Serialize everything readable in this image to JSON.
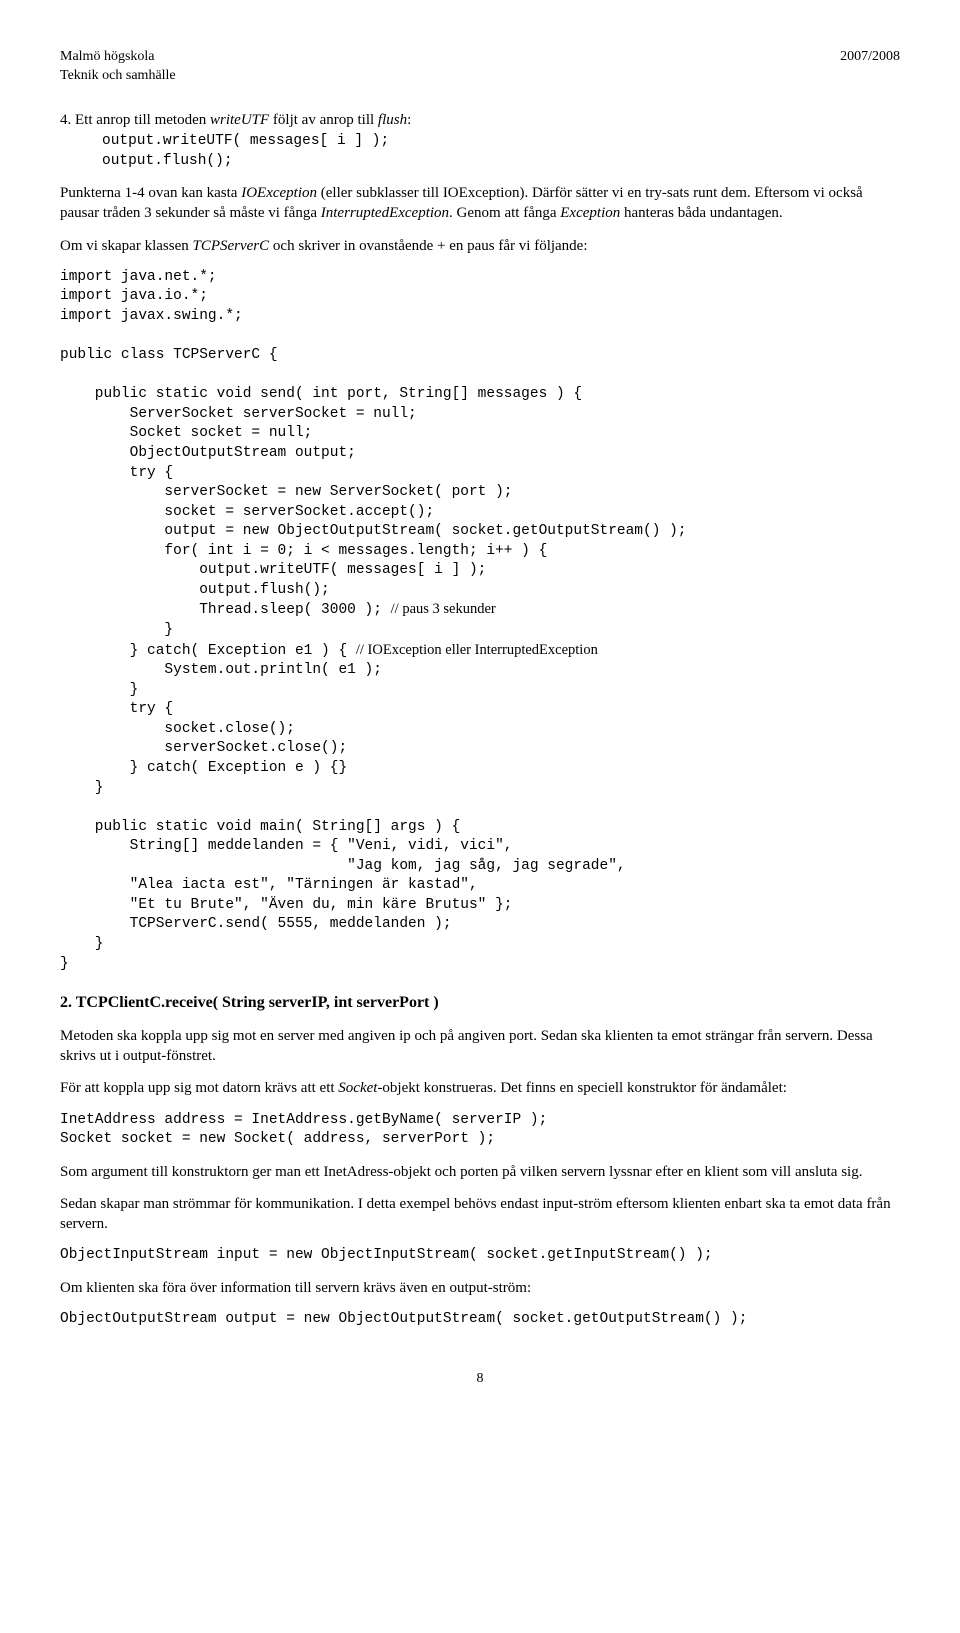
{
  "header": {
    "left_line1": "Malmö högskola",
    "left_line2": "Teknik och samhälle",
    "right": "2007/2008"
  },
  "item4": {
    "num": "4.",
    "text_plain1": "Ett anrop till metoden ",
    "text_italic1": "writeUTF",
    "text_plain2": " följt av anrop till ",
    "text_italic2": "flush",
    "text_plain3": ":",
    "code": "output.writeUTF( messages[ i ] );\noutput.flush();"
  },
  "para1": {
    "p1": "Punkterna 1-4 ovan kan kasta ",
    "i1": "IOException",
    "p2": " (eller subklasser till IOException). Därför sätter vi en try-sats runt dem. Eftersom vi också pausar tråden 3 sekunder så måste vi fånga ",
    "i2": "InterruptedException",
    "p3": ". Genom att fånga ",
    "i3": "Exception",
    "p4": " hanteras båda undantagen."
  },
  "para2": {
    "p1": "Om vi skapar klassen ",
    "i1": "TCPServerC",
    "p2": " och skriver in ovanstående + en paus får vi följande:"
  },
  "code_big": {
    "l1": "import java.net.*;",
    "l2": "import java.io.*;",
    "l3": "import javax.swing.*;",
    "l4": "public class TCPServerC {",
    "l5": "    public static void send( int port, String[] messages ) {",
    "l6": "        ServerSocket serverSocket = null;",
    "l7": "        Socket socket = null;",
    "l8": "        ObjectOutputStream output;",
    "l9": "        try {",
    "l10": "            serverSocket = new ServerSocket( port );",
    "l11": "            socket = serverSocket.accept();",
    "l12": "            output = new ObjectOutputStream( socket.getOutputStream() );",
    "l13": "            for( int i = 0; i < messages.length; i++ ) {",
    "l14": "                output.writeUTF( messages[ i ] );",
    "l15": "                output.flush();",
    "l16a": "                Thread.sleep( 3000 ); ",
    "l16b": "// paus 3 sekunder",
    "l17": "            }",
    "l18a": "        } catch( Exception e1 ) { ",
    "l18b": "// IOException eller InterruptedException",
    "l19": "            System.out.println( e1 );",
    "l20": "        }",
    "l21": "        try {",
    "l22": "            socket.close();",
    "l23": "            serverSocket.close();",
    "l24": "        } catch( Exception e ) {}",
    "l25": "    }",
    "l26": "    public static void main( String[] args ) {",
    "l27": "        String[] meddelanden = { \"Veni, vidi, vici\",",
    "l28": "                                 \"Jag kom, jag såg, jag segrade\",",
    "l29": "        \"Alea iacta est\", \"Tärningen är kastad\",",
    "l30": "        \"Et tu Brute\", \"Även du, min käre Brutus\" };",
    "l31": "        TCPServerC.send( 5555, meddelanden );",
    "l32": "    }",
    "l33": "}"
  },
  "section2_title": "2. TCPClientC.receive( String serverIP, int serverPort )",
  "para3": "Metoden ska koppla upp sig mot en server med angiven ip och på angiven port. Sedan ska klienten ta emot strängar från servern. Dessa skrivs ut i output-fönstret.",
  "para4": {
    "p1": "För att koppla upp sig mot datorn krävs att ett ",
    "i1": "Socket",
    "p2": "-objekt konstrueras. Det finns en speciell konstruktor för ändamålet:"
  },
  "code2": "InetAddress address = InetAddress.getByName( serverIP );\nSocket socket = new Socket( address, serverPort );",
  "para5": "Som argument till konstruktorn ger man ett InetAdress-objekt och porten på vilken servern lyssnar efter en klient som vill ansluta sig.",
  "para6": "Sedan skapar man strömmar för kommunikation. I detta exempel behövs endast input-ström eftersom klienten enbart ska ta emot data från servern.",
  "code3": "ObjectInputStream input = new ObjectInputStream( socket.getInputStream() );",
  "para7": "Om klienten ska föra över information till servern krävs även en output-ström:",
  "code4": "ObjectOutputStream output = new ObjectOutputStream( socket.getOutputStream() );",
  "page_number": "8"
}
